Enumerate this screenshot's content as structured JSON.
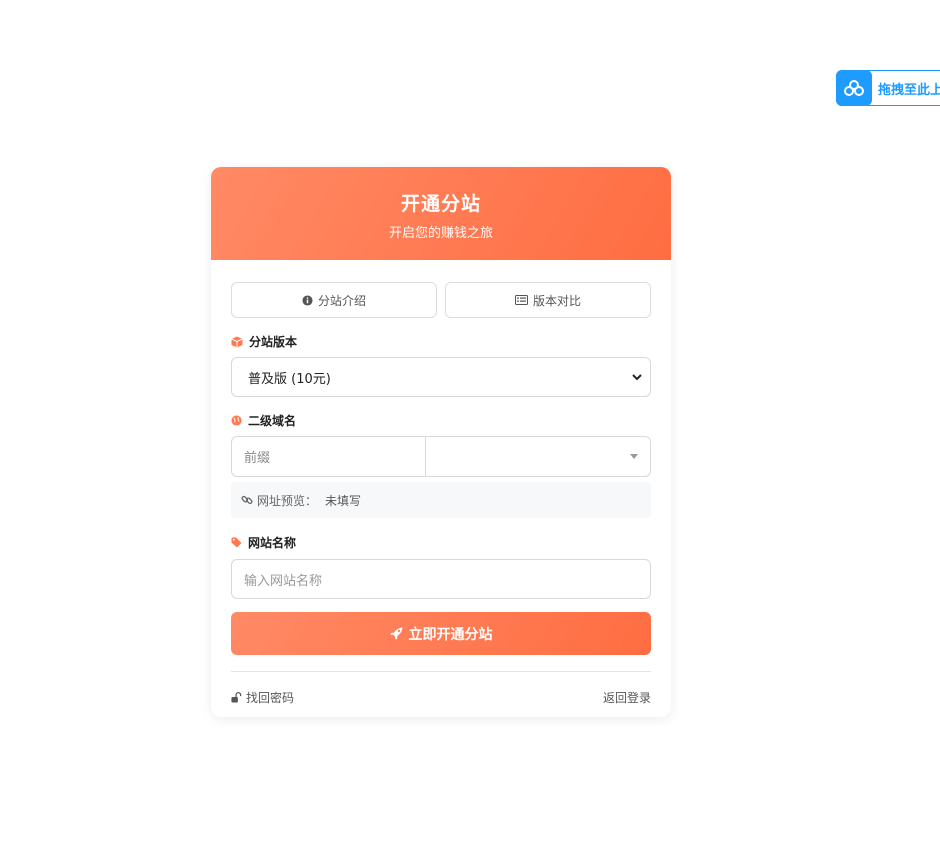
{
  "float_widget": {
    "label": "拖拽至此上"
  },
  "header": {
    "title": "开通分站",
    "subtitle": "开启您的赚钱之旅"
  },
  "buttons": {
    "intro": "分站介绍",
    "compare": "版本对比"
  },
  "version": {
    "label": "分站版本",
    "selected": "普及版 (10元)"
  },
  "domain": {
    "label": "二级域名",
    "prefix_placeholder": "前缀",
    "suffix_selected": ""
  },
  "preview": {
    "label": "网址预览：",
    "value": "未填写"
  },
  "site_name": {
    "label": "网站名称",
    "placeholder": "输入网站名称"
  },
  "submit": {
    "label": "立即开通分站"
  },
  "footer": {
    "forgot": "找回密码",
    "back": "返回登录"
  },
  "colors": {
    "accent_start": "#ff8a65",
    "accent_end": "#ff6d42",
    "widget_blue": "#1e9bff"
  },
  "icons": {
    "intro": "info-circle-icon",
    "compare": "list-table-icon",
    "version": "cube-icon",
    "domain": "globe-icon",
    "preview": "link-icon",
    "site_name": "tag-icon",
    "submit": "rocket-icon",
    "forgot": "unlock-icon",
    "widget": "baidu-cloud-icon"
  }
}
